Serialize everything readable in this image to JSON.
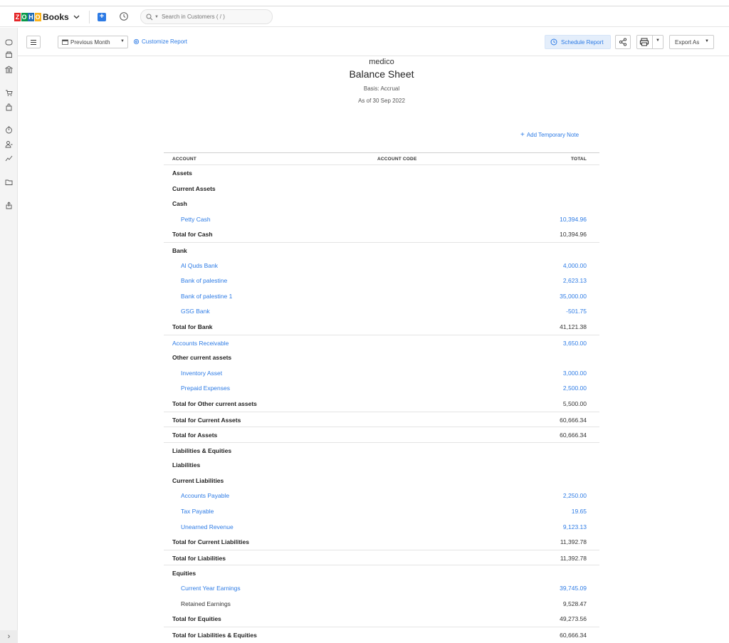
{
  "app": {
    "logo_letters": [
      "Z",
      "O",
      "H",
      "O"
    ],
    "logo_colors": [
      "#e42527",
      "#089949",
      "#226db4",
      "#f9b21d"
    ],
    "product": "Books",
    "search_placeholder": "Search in Customers ( / )"
  },
  "toolbar": {
    "period_label": "Previous Month",
    "customize_label": "Customize Report",
    "schedule_label": "Schedule Report",
    "export_label": "Export As"
  },
  "report": {
    "org": "medico",
    "title": "Balance Sheet",
    "basis": "Basis: Accrual",
    "as_of": "As of 30 Sep 2022",
    "add_note": "Add Temporary Note",
    "columns": {
      "account": "ACCOUNT",
      "code": "ACCOUNT CODE",
      "total": "TOTAL"
    },
    "rows": [
      {
        "name": "Assets",
        "total": "",
        "level": 0,
        "style": "bold"
      },
      {
        "name": "Current Assets",
        "total": "",
        "level": 0,
        "style": "bold"
      },
      {
        "name": "Cash",
        "total": "",
        "level": 0,
        "style": "bold"
      },
      {
        "name": "Petty Cash",
        "total": "10,394.96",
        "level": 1,
        "style": "link"
      },
      {
        "name": "Total for Cash",
        "total": "10,394.96",
        "level": 0,
        "style": "total"
      },
      {
        "name": "Bank",
        "total": "",
        "level": 0,
        "style": "bold",
        "border": true
      },
      {
        "name": "Al Quds Bank",
        "total": "4,000.00",
        "level": 1,
        "style": "link"
      },
      {
        "name": "Bank of palestine",
        "total": "2,623.13",
        "level": 1,
        "style": "link"
      },
      {
        "name": "Bank of palestine 1",
        "total": "35,000.00",
        "level": 1,
        "style": "link"
      },
      {
        "name": "GSG Bank",
        "total": "-501.75",
        "level": 1,
        "style": "link"
      },
      {
        "name": "Total for Bank",
        "total": "41,121.38",
        "level": 0,
        "style": "total"
      },
      {
        "name": "Accounts Receivable",
        "total": "3,650.00",
        "level": 0,
        "style": "link",
        "border": true
      },
      {
        "name": "Other current assets",
        "total": "",
        "level": 0,
        "style": "bold"
      },
      {
        "name": "Inventory Asset",
        "total": "3,000.00",
        "level": 1,
        "style": "link"
      },
      {
        "name": "Prepaid Expenses",
        "total": "2,500.00",
        "level": 1,
        "style": "link"
      },
      {
        "name": "Total for Other current assets",
        "total": "5,500.00",
        "level": 0,
        "style": "total"
      },
      {
        "name": "Total for Current Assets",
        "total": "60,666.34",
        "level": 0,
        "style": "total",
        "border": true
      },
      {
        "name": "Total for Assets",
        "total": "60,666.34",
        "level": 0,
        "style": "total",
        "border": true
      },
      {
        "name": "Liabilities & Equities",
        "total": "",
        "level": 0,
        "style": "bold",
        "border": true
      },
      {
        "name": "Liabilities",
        "total": "",
        "level": 0,
        "style": "bold"
      },
      {
        "name": "Current Liabilities",
        "total": "",
        "level": 0,
        "style": "bold"
      },
      {
        "name": "Accounts Payable",
        "total": "2,250.00",
        "level": 1,
        "style": "link"
      },
      {
        "name": "Tax Payable",
        "total": "19.65",
        "level": 1,
        "style": "link"
      },
      {
        "name": "Unearned Revenue",
        "total": "9,123.13",
        "level": 1,
        "style": "link"
      },
      {
        "name": "Total for Current Liabilities",
        "total": "11,392.78",
        "level": 0,
        "style": "total"
      },
      {
        "name": "Total for Liabilities",
        "total": "11,392.78",
        "level": 0,
        "style": "total",
        "border": true
      },
      {
        "name": "Equities",
        "total": "",
        "level": 0,
        "style": "bold",
        "border": true
      },
      {
        "name": "Current Year Earnings",
        "total": "39,745.09",
        "level": 1,
        "style": "link"
      },
      {
        "name": "Retained Earnings",
        "total": "9,528.47",
        "level": 1,
        "style": "plain"
      },
      {
        "name": "Total for Equities",
        "total": "49,273.56",
        "level": 0,
        "style": "total"
      },
      {
        "name": "Total for Liabilities & Equities",
        "total": "60,666.34",
        "level": 0,
        "style": "total",
        "border": true
      }
    ]
  },
  "icons": {
    "rail": [
      "dashboard-icon",
      "items-icon",
      "banking-icon",
      "sales-icon",
      "purchases-icon",
      "time-tracking-icon",
      "accountant-icon",
      "reports-icon",
      "documents-icon",
      "apps-icon"
    ],
    "expand": "›"
  }
}
